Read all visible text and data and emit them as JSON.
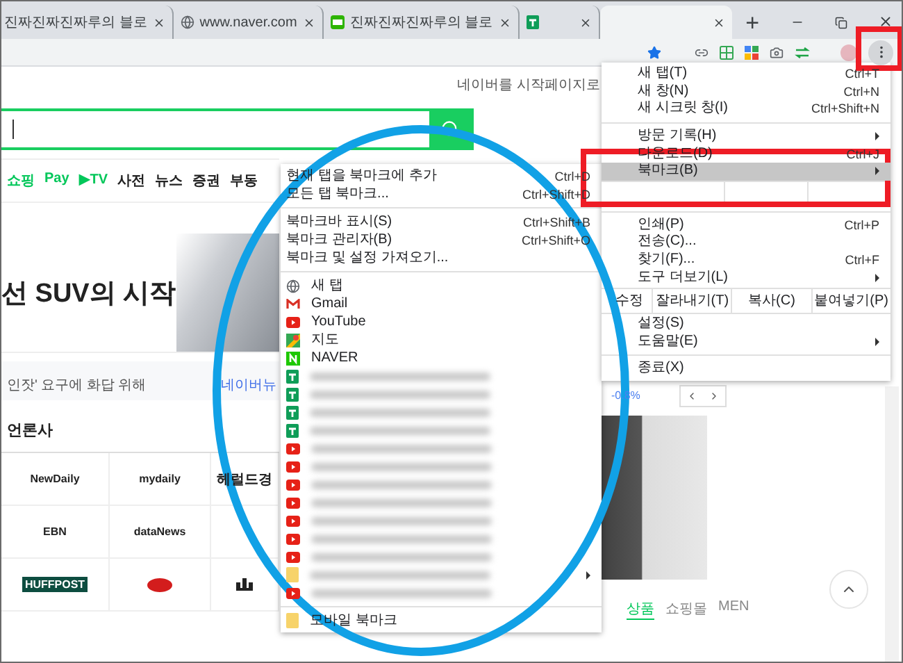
{
  "tabs": [
    {
      "title": "진짜진짜진짜루의 블로",
      "kind": "blank",
      "selected": false
    },
    {
      "title": "www.naver.com",
      "kind": "globe",
      "selected": false
    },
    {
      "title": "진짜진짜진짜루의 블로",
      "kind": "blog",
      "selected": false
    },
    {
      "kind": "sheets",
      "selected": false
    },
    {
      "kind": "blank",
      "selected": true
    }
  ],
  "new_tab": "+",
  "page": {
    "start_page_link": "네이버를 시작페이지로",
    "nav": [
      {
        "label": "쇼핑",
        "kind": "green"
      },
      {
        "label": "Pay",
        "kind": "green"
      },
      {
        "label": "▶TV",
        "kind": "green"
      },
      {
        "label": "사전",
        "kind": "plain"
      },
      {
        "label": "뉴스",
        "kind": "plain"
      },
      {
        "label": "증권",
        "kind": "plain"
      },
      {
        "label": "부동",
        "kind": "plain"
      }
    ],
    "banner_title": "선 SUV의 시작",
    "news_line": "인잣' 요구에 화답 위해",
    "news_link": "네이버뉴",
    "press_heading": "언론사",
    "press": [
      {
        "name": "NewDaily",
        "kind": "text"
      },
      {
        "name": "mydaily",
        "kind": "text"
      },
      {
        "name": "헤럴드경",
        "kind": "text"
      },
      {
        "name": "EBN",
        "kind": "text"
      },
      {
        "name": "dataNews",
        "kind": "text"
      },
      {
        "kind": "blank"
      },
      {
        "name": "HUFFPOST",
        "kind": "dark"
      },
      {
        "kind": "badge"
      },
      {
        "kind": "mountain"
      }
    ],
    "stock_change": "-0.8%",
    "shop_tabs": [
      {
        "label": "상품",
        "selected": true
      },
      {
        "label": "쇼핑몰",
        "selected": false
      },
      {
        "label": "MEN",
        "selected": false
      }
    ]
  },
  "chrome_menu": [
    {
      "kind": "item",
      "label": "새 탭(T)",
      "shortcut": "Ctrl+T"
    },
    {
      "kind": "item",
      "label": "새 창(N)",
      "shortcut": "Ctrl+N"
    },
    {
      "kind": "item",
      "label": "새 시크릿 창(I)",
      "shortcut": "Ctrl+Shift+N"
    },
    {
      "kind": "separator"
    },
    {
      "kind": "item",
      "label": "방문 기록(H)",
      "submenu": true
    },
    {
      "kind": "item",
      "label": "다운로드(D)",
      "shortcut": "Ctrl+J"
    },
    {
      "kind": "item",
      "label": "북마크(B)",
      "submenu": true,
      "selected": true
    },
    {
      "kind": "zoom"
    },
    {
      "kind": "separator"
    },
    {
      "kind": "item",
      "label": "인쇄(P)",
      "shortcut": "Ctrl+P"
    },
    {
      "kind": "item",
      "label": "전송(C)..."
    },
    {
      "kind": "item",
      "label": "찾기(F)...",
      "shortcut": "Ctrl+F"
    },
    {
      "kind": "item",
      "label": "도구 더보기(L)",
      "submenu": true
    },
    {
      "kind": "edit",
      "label": "수정",
      "buttons": [
        "잘라내기(T)",
        "복사(C)",
        "붙여넣기(P)"
      ]
    },
    {
      "kind": "item",
      "label": "설정(S)"
    },
    {
      "kind": "item",
      "label": "도움말(E)",
      "submenu": true
    },
    {
      "kind": "separator"
    },
    {
      "kind": "item",
      "label": "종료(X)"
    }
  ],
  "bookmark_menu": [
    {
      "kind": "item",
      "label": "현재 탭을 북마크에 추가",
      "shortcut": "Ctrl+D"
    },
    {
      "kind": "item",
      "label": "모든 탭 북마크...",
      "shortcut": "Ctrl+Shift+D"
    },
    {
      "kind": "separator"
    },
    {
      "kind": "item",
      "label": "북마크바 표시(S)",
      "shortcut": "Ctrl+Shift+B"
    },
    {
      "kind": "item",
      "label": "북마크 관리자(B)",
      "shortcut": "Ctrl+Shift+O"
    },
    {
      "kind": "item",
      "label": "북마크 및 설정 가져오기..."
    },
    {
      "kind": "separator"
    },
    {
      "kind": "globe",
      "label": "새 탭"
    },
    {
      "kind": "gmail",
      "label": "Gmail"
    },
    {
      "kind": "youtube",
      "label": "YouTube"
    },
    {
      "kind": "maps",
      "label": "지도"
    },
    {
      "kind": "naver",
      "label": "NAVER"
    },
    {
      "kind": "blurred_sheets"
    },
    {
      "kind": "blurred_sheets"
    },
    {
      "kind": "blurred_sheets"
    },
    {
      "kind": "blurred_sheets"
    },
    {
      "kind": "blurred_youtube"
    },
    {
      "kind": "blurred_youtube"
    },
    {
      "kind": "blurred_youtube"
    },
    {
      "kind": "blurred_youtube"
    },
    {
      "kind": "blurred_youtube"
    },
    {
      "kind": "blurred_youtube"
    },
    {
      "kind": "blurred_youtube"
    },
    {
      "kind": "blurred_folder",
      "submenu": true
    },
    {
      "kind": "blurred_youtube"
    },
    {
      "kind": "separator"
    },
    {
      "kind": "folder",
      "label": "모바일 북마크"
    }
  ]
}
